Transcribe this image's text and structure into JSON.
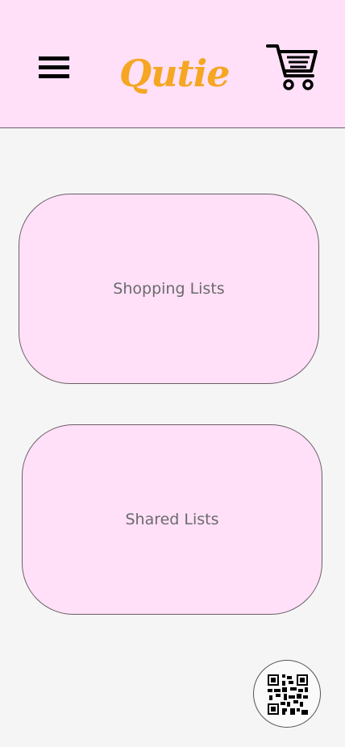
{
  "header": {
    "logo_text": "Qutie",
    "logo_color": "#f5a623",
    "background_color": "#ffe0f8",
    "menu_icon": "hamburger-menu-icon",
    "cart_icon": "shopping-cart-icon"
  },
  "main": {
    "cards": [
      {
        "label": "Shopping Lists"
      },
      {
        "label": "Shared Lists"
      }
    ]
  },
  "fab": {
    "icon": "qr-code-icon"
  }
}
